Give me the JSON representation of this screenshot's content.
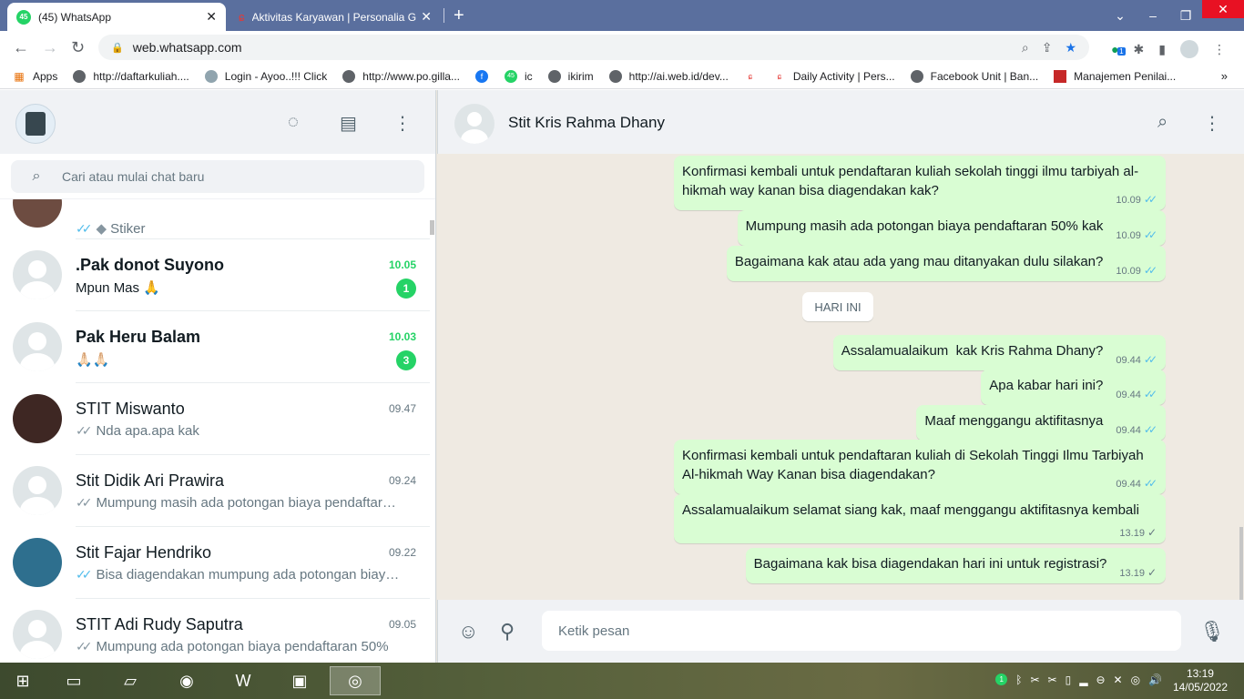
{
  "browser": {
    "tabs": [
      {
        "title": "(45) WhatsApp",
        "badge": "45"
      },
      {
        "title": "Aktivitas Karyawan | Personalia G"
      }
    ],
    "url": "web.whatsapp.com",
    "bookmarks": [
      {
        "label": "Apps"
      },
      {
        "label": "http://daftarkuliah...."
      },
      {
        "label": "Login - Ayoo..!!! Click"
      },
      {
        "label": "http://www.po.gilla..."
      },
      {
        "label": ""
      },
      {
        "label": "ic"
      },
      {
        "label": "ikirim"
      },
      {
        "label": "http://ai.web.id/dev..."
      },
      {
        "label": ""
      },
      {
        "label": "Daily Activity | Pers..."
      },
      {
        "label": "Facebook Unit | Ban..."
      },
      {
        "label": "Manajemen Penilai..."
      }
    ],
    "ext_badge": "1"
  },
  "sidebar": {
    "search_placeholder": "Cari atau mulai chat baru",
    "chats": [
      {
        "name": "",
        "time": "",
        "preview": "Stiker",
        "count": ""
      },
      {
        "name": ".Pak donot Suyono",
        "time": "10.05",
        "preview": "Mpun Mas 🙏",
        "count": "1"
      },
      {
        "name": "Pak Heru Balam",
        "time": "10.03",
        "preview": "🙏🏻🙏🏻",
        "count": "3"
      },
      {
        "name": "STIT Miswanto",
        "time": "09.47",
        "preview": "Nda apa.apa kak",
        "count": ""
      },
      {
        "name": "Stit Didik Ari Prawira",
        "time": "09.24",
        "preview": "Mumpung masih ada potongan biaya pendaftar…",
        "count": ""
      },
      {
        "name": "Stit Fajar Hendriko",
        "time": "09.22",
        "preview": "Bisa diagendakan mumpung ada potongan biay…",
        "count": ""
      },
      {
        "name": "STIT Adi Rudy Saputra",
        "time": "09.05",
        "preview": "Mumpung ada potongan biaya pendaftaran 50%",
        "count": ""
      }
    ]
  },
  "conversation": {
    "contact_name": "Stit Kris Rahma Dhany",
    "day_chip": "HARI INI",
    "messages": [
      {
        "text": "Konfirmasi kembali untuk pendaftaran kuliah sekolah tinggi ilmu tarbiyah al-hikmah way kanan bisa diagendakan kak?",
        "time": "10.09",
        "status": "read"
      },
      {
        "text": "Mumpung masih ada potongan biaya pendaftaran 50% kak",
        "time": "10.09",
        "status": "read"
      },
      {
        "text": "Bagaimana kak atau ada yang mau ditanyakan dulu silakan?",
        "time": "10.09",
        "status": "read"
      },
      {
        "text": "Assalamualaikum  kak Kris Rahma Dhany?",
        "time": "09.44",
        "status": "read"
      },
      {
        "text": "Apa kabar hari ini?",
        "time": "09.44",
        "status": "read"
      },
      {
        "text": "Maaf menggangu aktifitasnya",
        "time": "09.44",
        "status": "read"
      },
      {
        "text": "Konfirmasi kembali untuk pendaftaran kuliah di Sekolah Tinggi Ilmu Tarbiyah Al-hikmah Way Kanan bisa diagendakan?",
        "time": "09.44",
        "status": "read"
      },
      {
        "text": "Assalamualaikum selamat siang kak, maaf menggangu aktifitasnya kembali",
        "time": "13.19",
        "status": "sent"
      },
      {
        "text": "Bagaimana kak bisa diagendakan hari ini untuk registrasi?",
        "time": "13.19",
        "status": "sent"
      }
    ],
    "composer_placeholder": "Ketik pesan"
  },
  "taskbar": {
    "time": "13:19",
    "date": "14/05/2022",
    "tray_badge": "1"
  },
  "colors": {
    "whatsapp_green": "#25d366",
    "outgoing_bubble": "#d9fdd3",
    "read_tick": "#53bdeb",
    "tabbar": "#5a6f9e"
  }
}
